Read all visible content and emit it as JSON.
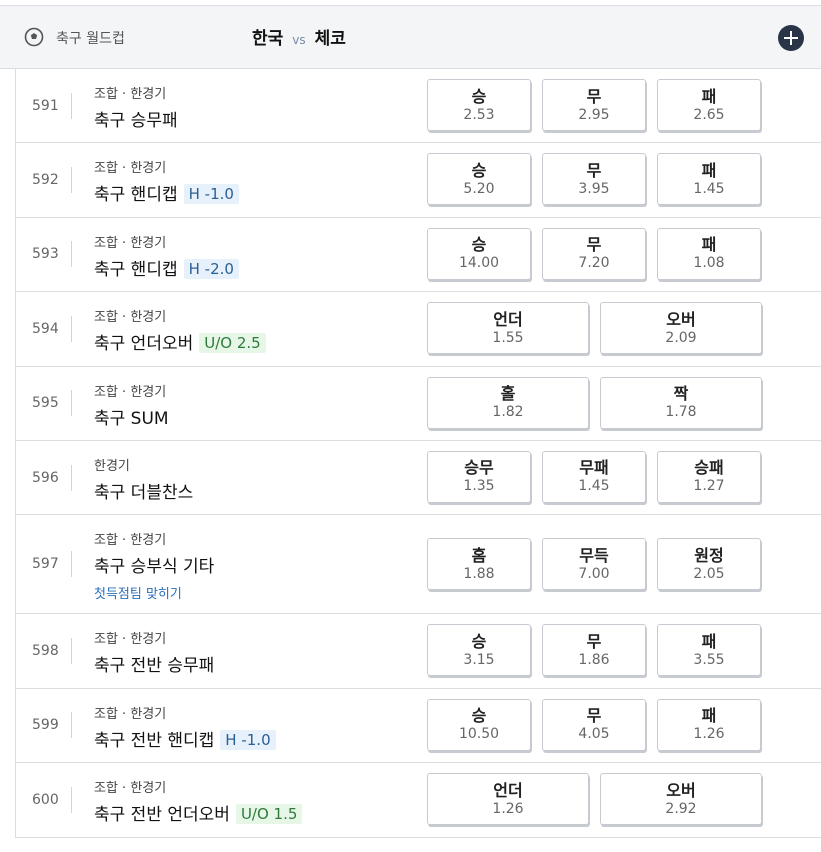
{
  "header": {
    "league": "축구 월드컵",
    "home": "한국",
    "vs": "vs",
    "away": "체코"
  },
  "rows": [
    {
      "num": "591",
      "sub": "조합 · 한경기",
      "title": "축구 승무패",
      "tag": "",
      "note": "",
      "odds": [
        {
          "label": "승",
          "value": "2.53"
        },
        {
          "label": "무",
          "value": "2.95"
        },
        {
          "label": "패",
          "value": "2.65"
        }
      ]
    },
    {
      "num": "592",
      "sub": "조합 · 한경기",
      "title": "축구 핸디캡",
      "tag": "H -1.0",
      "note": "",
      "odds": [
        {
          "label": "승",
          "value": "5.20"
        },
        {
          "label": "무",
          "value": "3.95"
        },
        {
          "label": "패",
          "value": "1.45"
        }
      ]
    },
    {
      "num": "593",
      "sub": "조합 · 한경기",
      "title": "축구 핸디캡",
      "tag": "H -2.0",
      "note": "",
      "odds": [
        {
          "label": "승",
          "value": "14.00"
        },
        {
          "label": "무",
          "value": "7.20"
        },
        {
          "label": "패",
          "value": "1.08"
        }
      ]
    },
    {
      "num": "594",
      "sub": "조합 · 한경기",
      "title": "축구 언더오버",
      "tag": "U/O 2.5",
      "note": "",
      "odds": [
        {
          "label": "언더",
          "value": "1.55"
        },
        {
          "label": "오버",
          "value": "2.09"
        }
      ]
    },
    {
      "num": "595",
      "sub": "조합 · 한경기",
      "title": "축구 SUM",
      "tag": "",
      "note": "",
      "odds": [
        {
          "label": "홀",
          "value": "1.82"
        },
        {
          "label": "짝",
          "value": "1.78"
        }
      ]
    },
    {
      "num": "596",
      "sub": "한경기",
      "title": "축구 더블찬스",
      "tag": "",
      "note": "",
      "odds": [
        {
          "label": "승무",
          "value": "1.35"
        },
        {
          "label": "무패",
          "value": "1.45"
        },
        {
          "label": "승패",
          "value": "1.27"
        }
      ]
    },
    {
      "num": "597",
      "sub": "조합 · 한경기",
      "title": "축구 승부식 기타",
      "tag": "",
      "note": "첫득점팀 맞히기",
      "odds": [
        {
          "label": "홈",
          "value": "1.88"
        },
        {
          "label": "무득",
          "value": "7.00"
        },
        {
          "label": "원정",
          "value": "2.05"
        }
      ]
    },
    {
      "num": "598",
      "sub": "조합 · 한경기",
      "title": "축구 전반 승무패",
      "tag": "",
      "note": "",
      "odds": [
        {
          "label": "승",
          "value": "3.15"
        },
        {
          "label": "무",
          "value": "1.86"
        },
        {
          "label": "패",
          "value": "3.55"
        }
      ]
    },
    {
      "num": "599",
      "sub": "조합 · 한경기",
      "title": "축구 전반 핸디캡",
      "tag": "H -1.0",
      "note": "",
      "odds": [
        {
          "label": "승",
          "value": "10.50"
        },
        {
          "label": "무",
          "value": "4.05"
        },
        {
          "label": "패",
          "value": "1.26"
        }
      ]
    },
    {
      "num": "600",
      "sub": "조합 · 한경기",
      "title": "축구 전반 언더오버",
      "tag": "U/O 1.5",
      "note": "",
      "odds": [
        {
          "label": "언더",
          "value": "1.26"
        },
        {
          "label": "오버",
          "value": "2.92"
        }
      ]
    }
  ]
}
